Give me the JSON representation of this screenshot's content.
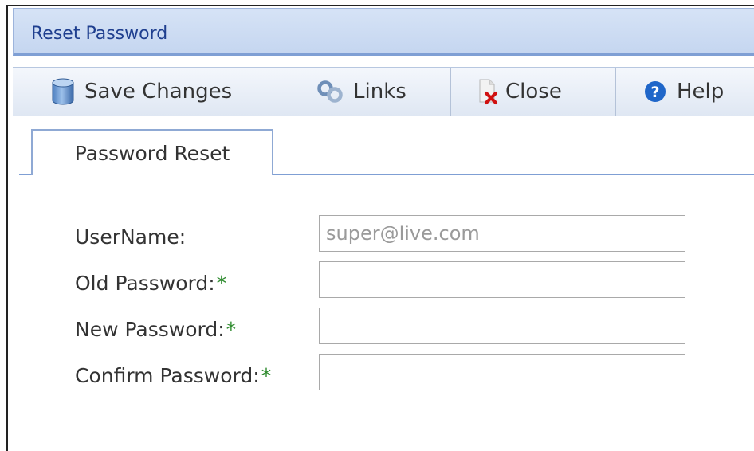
{
  "window": {
    "title": "Reset Password"
  },
  "toolbar": {
    "buttons": [
      {
        "label": "Save Changes",
        "icon": "database-icon"
      },
      {
        "label": "Links",
        "icon": "links-icon"
      },
      {
        "label": "Close",
        "icon": "close-document-icon"
      },
      {
        "label": "Help",
        "icon": "help-icon"
      }
    ]
  },
  "tabs": [
    {
      "label": "Password Reset",
      "active": true
    }
  ],
  "form": {
    "username": {
      "label": "UserName:",
      "value": "super@live.com"
    },
    "old_password": {
      "label": "Old Password:",
      "required_mark": "*",
      "value": ""
    },
    "new_password": {
      "label": "New Password:",
      "required_mark": "*",
      "value": ""
    },
    "confirm_password": {
      "label": "Confirm Password:",
      "required_mark": "*",
      "value": ""
    }
  },
  "colors": {
    "title_text": "#1f3f8f",
    "titlebar_bg": "#c5d6f0",
    "required_mark": "#2e8b2e",
    "accent_border": "#7f9fd4"
  }
}
